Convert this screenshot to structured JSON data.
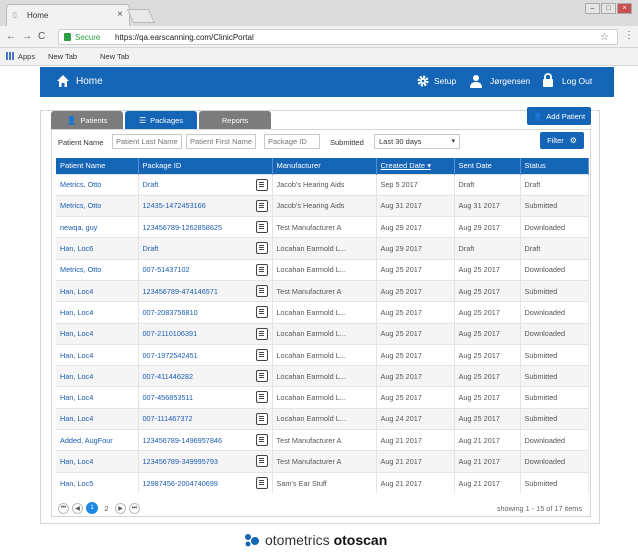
{
  "browser": {
    "tab_title": "Home",
    "tab_close": "×",
    "secure_label": "Secure",
    "url": "https://qa.earscanning.com/ClinicPortal",
    "bookmarks": [
      "Apps",
      "New Tab",
      "New Tab"
    ]
  },
  "header": {
    "home_label": "Home",
    "setup_label": "Setup",
    "user_label": "Jørgensen",
    "logout_label": "Log Out",
    "accent_color": "#1565b7"
  },
  "tabs": [
    {
      "label": "Patients",
      "active": false
    },
    {
      "label": "Packages",
      "active": true
    },
    {
      "label": "Reports",
      "active": false
    }
  ],
  "add_patient_label": "Add Patient",
  "filters": {
    "patient_name_label": "Patient Name",
    "last_name_placeholder": "Patient Last Name",
    "first_name_placeholder": "Patient First Name",
    "package_id_placeholder": "Package ID",
    "submitted_label": "Submitted",
    "submitted_value": "Last 30 days",
    "filter_button": "Filter"
  },
  "table": {
    "columns": [
      "Patient Name",
      "Package ID",
      "Manufacturer",
      "Created Date ▾",
      "Sent Date",
      "Status"
    ],
    "rows": [
      [
        "Metrics, Otto",
        "Draft",
        "Jacob's Hearing Aids",
        "Sep 5 2017",
        "Draft",
        "Draft"
      ],
      [
        "Metrics, Otto",
        "12435-1472453166",
        "Jacob's Hearing Aids",
        "Aug 31 2017",
        "Aug 31 2017",
        "Submitted"
      ],
      [
        "newqa, guy",
        "123456789-1262858625",
        "Test Manufacturer A",
        "Aug 29 2017",
        "Aug 29 2017",
        "Downloaded"
      ],
      [
        "Han, Loc6",
        "Draft",
        "Locahan Earmold L...",
        "Aug 29 2017",
        "Draft",
        "Draft"
      ],
      [
        "Metrics, Otto",
        "007-51437102",
        "Locahan Earmold L...",
        "Aug 25 2017",
        "Aug 25 2017",
        "Downloaded"
      ],
      [
        "Han, Loc4",
        "123456789-474146571",
        "Test Manufacturer A",
        "Aug 25 2017",
        "Aug 25 2017",
        "Submitted"
      ],
      [
        "Han, Loc4",
        "007-2083756810",
        "Locahan Earmold L...",
        "Aug 25 2017",
        "Aug 25 2017",
        "Downloaded"
      ],
      [
        "Han, Loc4",
        "007-2110106391",
        "Locahan Earmold L...",
        "Aug 25 2017",
        "Aug 25 2017",
        "Downloaded"
      ],
      [
        "Han, Loc4",
        "007-1972542451",
        "Locahan Earmold L...",
        "Aug 25 2017",
        "Aug 25 2017",
        "Submitted"
      ],
      [
        "Han, Loc4",
        "007-411446282",
        "Locahan Earmold L...",
        "Aug 25 2017",
        "Aug 25 2017",
        "Submitted"
      ],
      [
        "Han, Loc4",
        "007-456853511",
        "Locahan Earmold L...",
        "Aug 25 2017",
        "Aug 25 2017",
        "Submitted"
      ],
      [
        "Han, Loc4",
        "007-111467372",
        "Locahan Earmold L...",
        "Aug 24 2017",
        "Aug 25 2017",
        "Submitted"
      ],
      [
        "Added, AugFour",
        "123456789-1496957846",
        "Test Manufacturer A",
        "Aug 21 2017",
        "Aug 21 2017",
        "Downloaded"
      ],
      [
        "Han, Loc4",
        "123456789-349995793",
        "Test Manufacturer A",
        "Aug 21 2017",
        "Aug 21 2017",
        "Downloaded"
      ],
      [
        "Han, Loc5",
        "12987456-2004740699",
        "Sam's Ear Stuff",
        "Aug 21 2017",
        "Aug 21 2017",
        "Submitted"
      ]
    ]
  },
  "pager": {
    "pages": [
      "1",
      "2"
    ],
    "current": "1",
    "showing": "showing 1 - 15 of 17 items"
  },
  "brand": {
    "part1": "otometrics",
    "part2": "otoscan"
  }
}
